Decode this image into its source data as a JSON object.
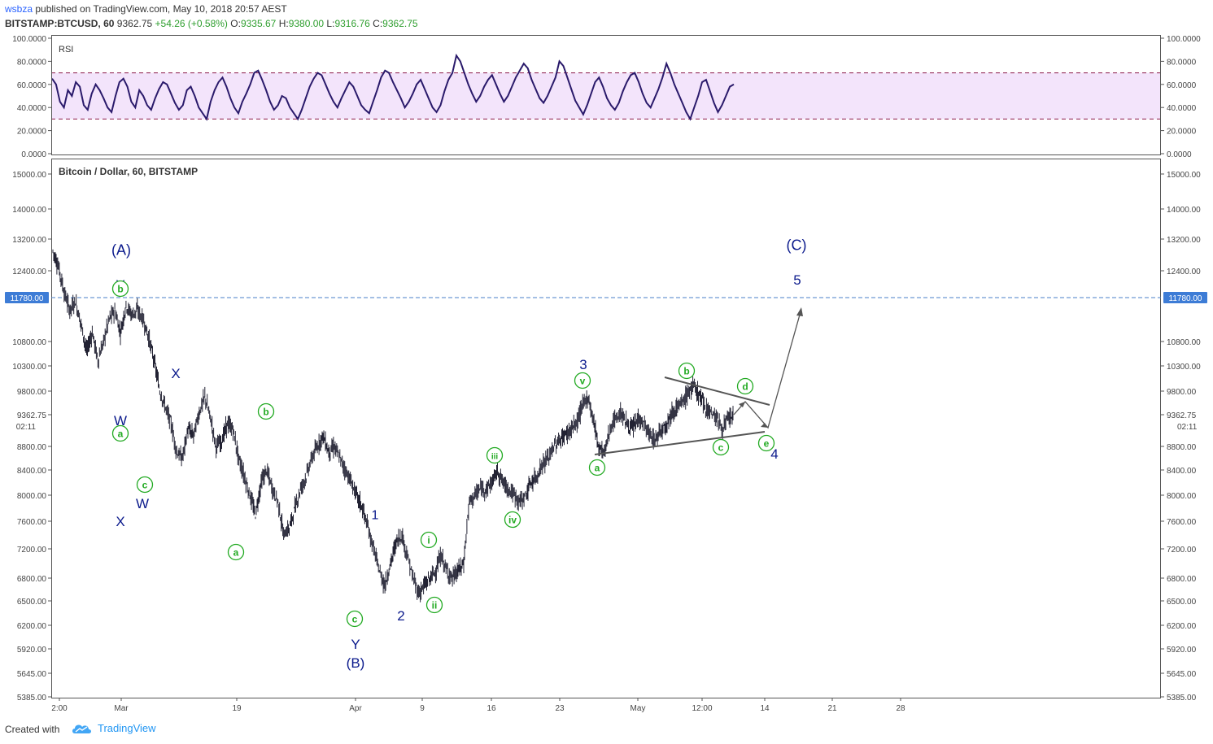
{
  "header": {
    "author": "wsbza",
    "published_text": " published on TradingView.com, May 10, 2018 20:57 AEST",
    "symbol": "BITSTAMP:BTCUSD, 60",
    "last": "9362.75",
    "change": "+54.26 (+0.58%)",
    "o_label": "O:",
    "o_value": "9335.67",
    "h_label": "H:",
    "h_value": "9380.00",
    "l_label": "L:",
    "l_value": "9316.76",
    "c_label": "C:",
    "c_value": "9362.75"
  },
  "footer": {
    "created_with": "Created with",
    "brand": "TradingView",
    "logo": "tradingview-cloud-icon"
  },
  "colors": {
    "rsi_line": "#2a1a6b",
    "rsi_band": "#f3e4fb",
    "rsi_band_border": "#8b1a4a",
    "candle": "#222233",
    "wave_blue": "#0b1a8c",
    "wave_green": "#22aa22",
    "level_line": "#4a7fc8",
    "level_badge": "#3d7cd6",
    "trendline": "#555555"
  },
  "chart_data": [
    {
      "type": "line",
      "title": "RSI",
      "ylim": [
        0,
        100
      ],
      "y_ticks": [
        "100.0000",
        "80.0000",
        "60.0000",
        "40.0000",
        "20.0000",
        "0.0000"
      ],
      "bands": [
        70,
        30
      ],
      "series": [
        {
          "values": [
            65,
            60,
            45,
            40,
            55,
            50,
            62,
            58,
            42,
            38,
            52,
            60,
            55,
            48,
            40,
            36,
            50,
            62,
            65,
            58,
            45,
            40,
            55,
            50,
            42,
            38,
            48,
            56,
            62,
            60,
            52,
            44,
            38,
            42,
            55,
            58,
            50,
            40,
            35,
            30,
            45,
            55,
            62,
            66,
            58,
            48,
            40,
            35,
            45,
            52,
            60,
            70,
            72,
            64,
            55,
            45,
            38,
            42,
            50,
            48,
            40,
            35,
            30,
            38,
            48,
            58,
            65,
            70,
            68,
            60,
            52,
            45,
            40,
            48,
            55,
            62,
            58,
            50,
            42,
            38,
            35,
            45,
            55,
            66,
            72,
            70,
            62,
            55,
            48,
            40,
            45,
            52,
            60,
            64,
            56,
            48,
            40,
            36,
            42,
            54,
            64,
            70,
            85,
            80,
            70,
            60,
            52,
            45,
            50,
            58,
            64,
            68,
            60,
            52,
            45,
            50,
            58,
            66,
            72,
            78,
            74,
            64,
            56,
            48,
            44,
            50,
            58,
            66,
            80,
            76,
            66,
            56,
            46,
            40,
            34,
            42,
            52,
            62,
            66,
            58,
            48,
            42,
            38,
            44,
            54,
            62,
            68,
            70,
            62,
            52,
            44,
            40,
            48,
            56,
            66,
            78,
            70,
            60,
            52,
            44,
            36,
            30,
            40,
            50,
            62,
            64,
            54,
            44,
            36,
            42,
            50,
            58,
            60
          ]
        }
      ]
    },
    {
      "type": "line",
      "title": "Bitcoin / Dollar, 60, BITSTAMP",
      "ylim": [
        5385,
        15300
      ],
      "y_ticks": [
        "15000.00",
        "14000.00",
        "13200.00",
        "12400.00",
        "11780.00",
        "10800.00",
        "10300.00",
        "9800.00",
        "9362.75",
        "8800.00",
        "8400.00",
        "8000.00",
        "7600.00",
        "7200.00",
        "6800.00",
        "6500.00",
        "6200.00",
        "5920.00",
        "5645.00",
        "5385.00"
      ],
      "x_ticks": [
        "2:00",
        "Mar",
        "19",
        "Apr",
        "9",
        "16",
        "23",
        "May",
        "12:00",
        "14",
        "21",
        "28"
      ],
      "current_price": "9362.75",
      "countdown": "02:11",
      "horizontal_level": "11780.00",
      "series": [
        {
          "values": [
            12900,
            12500,
            11900,
            11500,
            11700,
            11200,
            10600,
            11000,
            10400,
            10800,
            11300,
            11500,
            11000,
            11600,
            11400,
            11500,
            11300,
            10900,
            10400,
            9800,
            9500,
            9200,
            8700,
            8600,
            9100,
            9000,
            9400,
            9700,
            9300,
            8800,
            8900,
            9200,
            9100,
            8600,
            8300,
            8000,
            7700,
            8200,
            8400,
            8100,
            7900,
            7400,
            7500,
            7800,
            8100,
            8300,
            8600,
            8800,
            9000,
            8700,
            8800,
            8600,
            8400,
            8200,
            8000,
            7800,
            7500,
            7200,
            6900,
            6700,
            7000,
            7300,
            7400,
            7100,
            6800,
            6600,
            6700,
            6800,
            6900,
            7100,
            6900,
            6800,
            6900,
            7000,
            7900,
            8000,
            8100,
            8100,
            8200,
            8400,
            8200,
            8100,
            8000,
            7900,
            8000,
            8200,
            8300,
            8500,
            8600,
            8800,
            8900,
            9000,
            9100,
            9200,
            9500,
            9700,
            9300,
            8800,
            8700,
            9100,
            9300,
            9400,
            9200,
            9100,
            9300,
            9200,
            9000,
            8900,
            9100,
            9200,
            9400,
            9500,
            9600,
            9800,
            9900,
            9700,
            9500,
            9400,
            9300,
            9100,
            9300,
            9362
          ]
        }
      ],
      "annotations": {
        "blue": [
          "(A)",
          "Y",
          "X",
          "W",
          "W",
          "X",
          "(B)",
          "Y",
          "1",
          "2",
          "3",
          "4",
          "5",
          "(C)"
        ],
        "green": [
          "b",
          "a",
          "c",
          "a",
          "b",
          "c",
          "i",
          "ii",
          "iii",
          "iv",
          "v",
          "a",
          "b",
          "c",
          "d",
          "e"
        ]
      }
    }
  ]
}
